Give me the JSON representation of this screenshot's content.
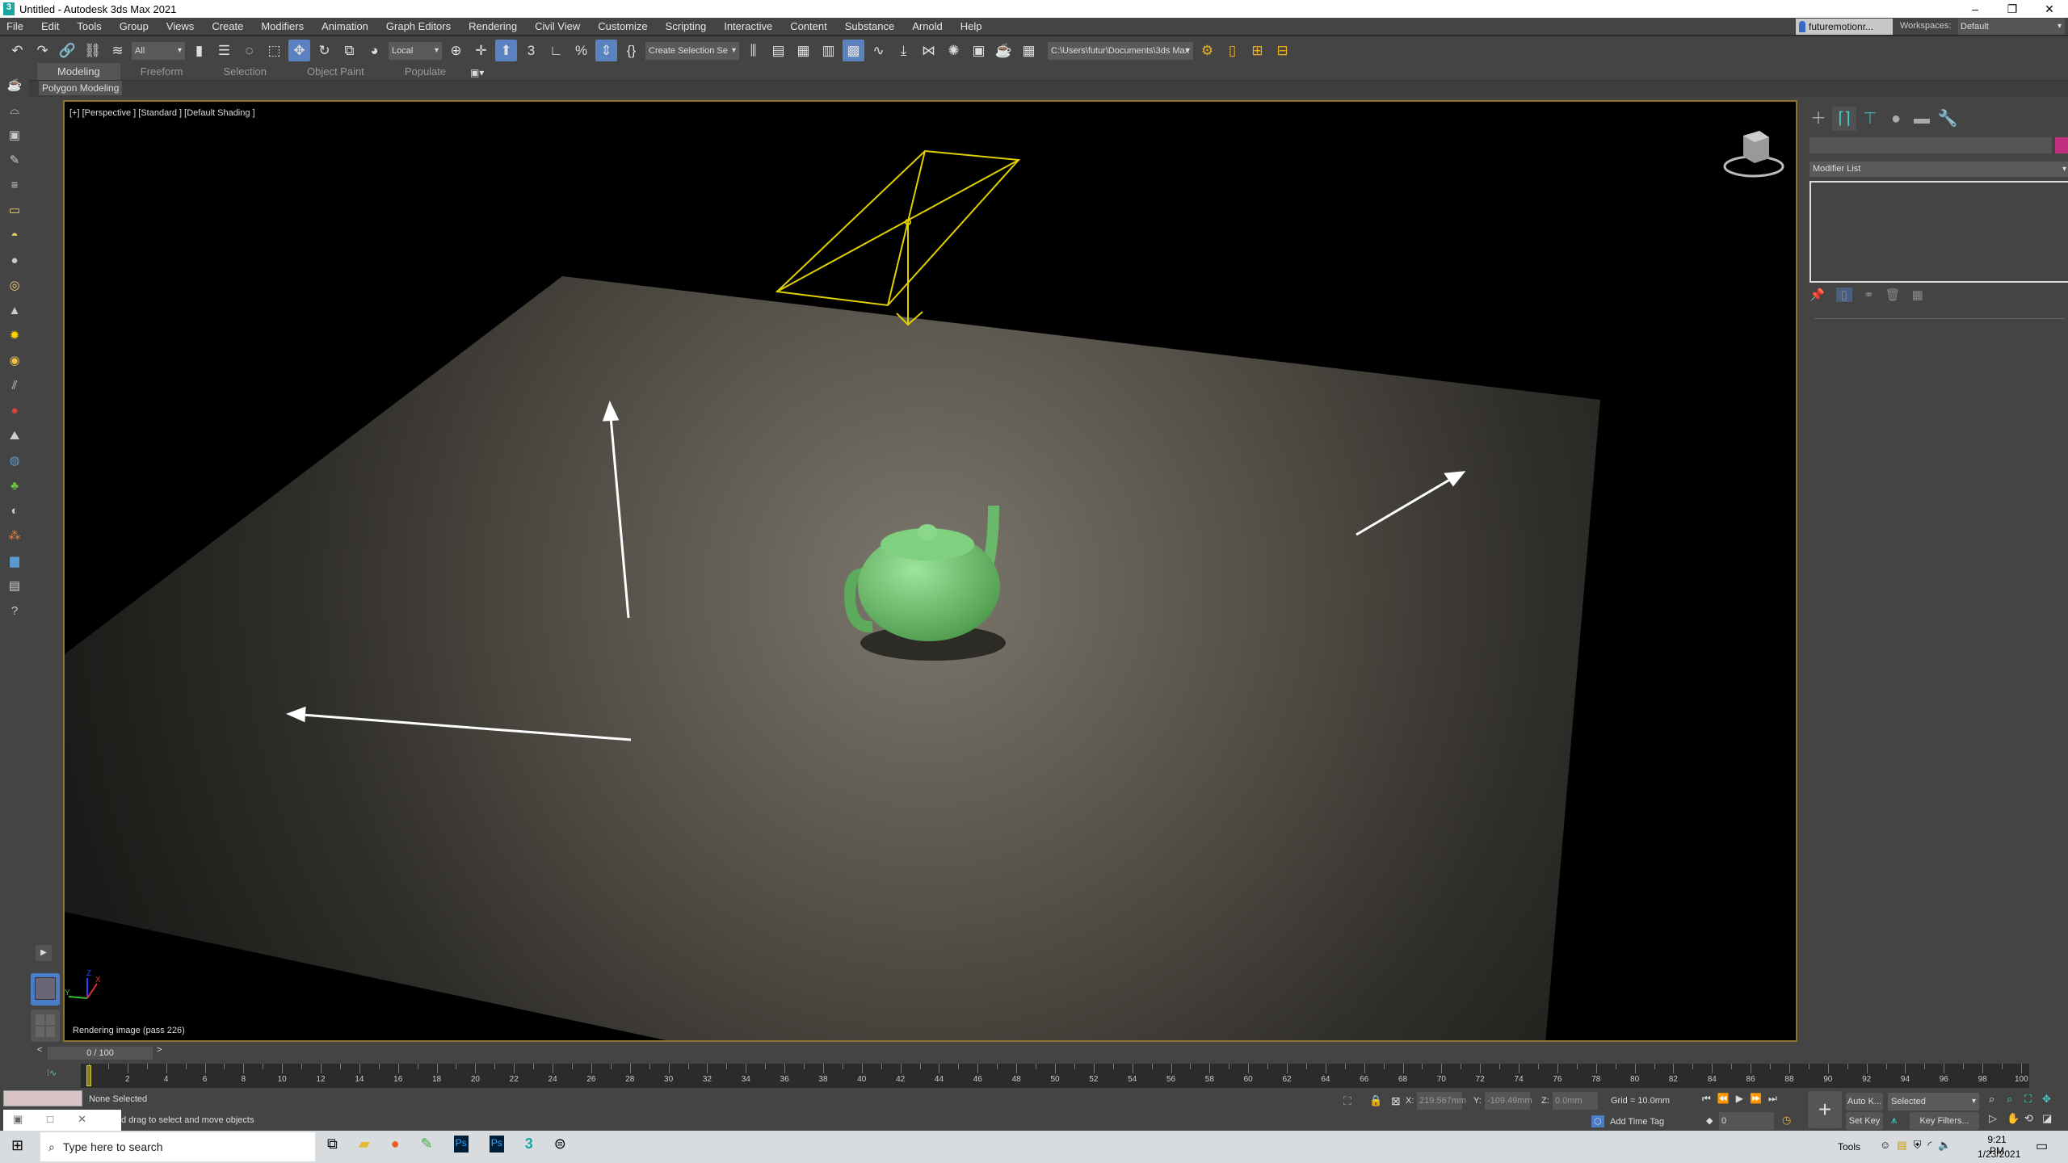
{
  "title": "Untitled - Autodesk 3ds Max 2021",
  "menu": [
    "File",
    "Edit",
    "Tools",
    "Group",
    "Views",
    "Create",
    "Modifiers",
    "Animation",
    "Graph Editors",
    "Rendering",
    "Civil View",
    "Customize",
    "Scripting",
    "Interactive",
    "Content",
    "Substance",
    "Arnold",
    "Help"
  ],
  "user": "futuremotionr...",
  "workspaces_label": "Workspaces:",
  "workspace": "Default",
  "toolbar": {
    "selection_filter": "All",
    "coord_system": "Local",
    "named_selection": "Create Selection Se",
    "project_path": "C:\\Users\\futur\\Documents\\3ds Max 2021"
  },
  "ribbon": {
    "tabs": [
      "Modeling",
      "Freeform",
      "Selection",
      "Object Paint",
      "Populate"
    ],
    "active": "Modeling",
    "panel": "Polygon Modeling"
  },
  "viewport": {
    "label": "[+] [Perspective ] [Standard ] [Default Shading ]",
    "status": "Rendering image (pass 226)",
    "axes": {
      "x": "X",
      "y": "Y",
      "z": "Z"
    }
  },
  "command_panel": {
    "modifier_list": "Modifier List",
    "object_color": "#c0307f"
  },
  "timeline": {
    "frame_display": "0 / 100",
    "start": 0,
    "end": 100,
    "label_step": 2,
    "current": 0
  },
  "status": {
    "selection": "None Selected",
    "prompt": "d drag to select and move objects",
    "x_label": "X:",
    "x": "219.567mm",
    "y_label": "Y:",
    "y": "-109.49mm",
    "z_label": "Z:",
    "z": "0.0mm",
    "grid": "Grid = 10.0mm",
    "add_time_tag": "Add Time Tag",
    "frame": "0",
    "auto_key": "Auto K...",
    "set_key": "Set Key",
    "key_mode": "Selected",
    "key_filters": "Key Filters..."
  },
  "taskbar": {
    "search_placeholder": "Type here to search",
    "tools": "Tools",
    "time": "9:21 PM",
    "date": "1/23/2021"
  },
  "colors": {
    "viewport_border": "#8a7530",
    "teapot": "#6fbf6f",
    "light_wire": "#e0d000",
    "accent": "#5a82c0"
  }
}
